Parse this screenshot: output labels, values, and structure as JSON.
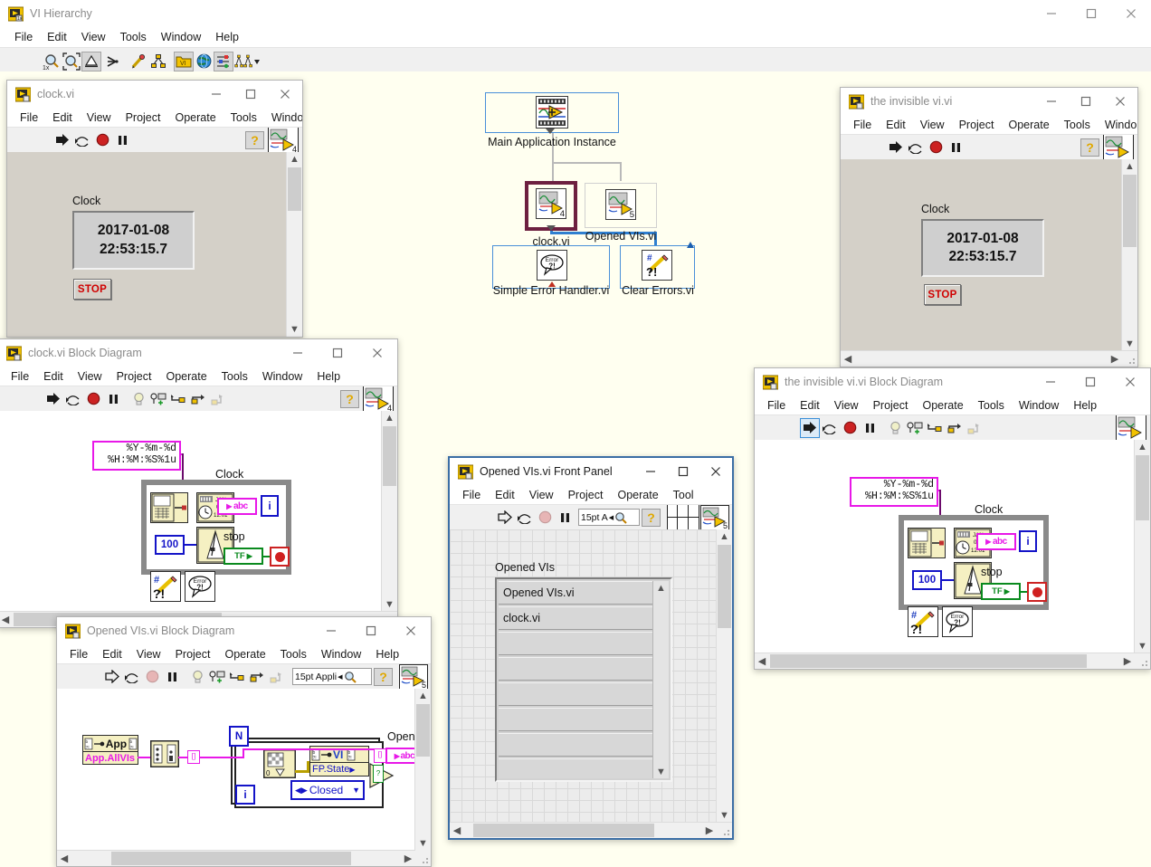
{
  "hierarchy_window": {
    "title": "VI Hierarchy",
    "icon": "labview-vi-icon",
    "menus": [
      "File",
      "Edit",
      "View",
      "Tools",
      "Window",
      "Help"
    ],
    "toolbar_icons": [
      "zoom-1x-icon",
      "zoom-fit-icon",
      "hierarchy-vertical-icon",
      "hierarchy-horizontal-icon",
      "pencil-icon",
      "tree-nodes-icon",
      "vi-folder-icon",
      "globe-icon",
      "filter-icon",
      "layout-dropdown-icon"
    ],
    "window_controls": [
      "minimize",
      "maximize",
      "close"
    ],
    "canvas_bg": "#fffff0",
    "nodes": [
      {
        "label": "Main Application Instance",
        "badge": "",
        "selected": false,
        "border": "#4a90d9"
      },
      {
        "label": "clock.vi",
        "badge": "4",
        "selected": true,
        "border": "#6d2040"
      },
      {
        "label": "Opened VIs.vi",
        "badge": "5",
        "selected": false,
        "border": "#d0d0d0"
      },
      {
        "label": "Simple Error Handler.vi",
        "badge": "",
        "selected": false,
        "border": "#4a90d9"
      },
      {
        "label": "Clear Errors.vi",
        "badge": "",
        "selected": false,
        "border": "#4a90d9"
      }
    ]
  },
  "clock_fp": {
    "title": "clock.vi",
    "menus": [
      "File",
      "Edit",
      "View",
      "Project",
      "Operate",
      "Tools",
      "Windo"
    ],
    "toolbar_icons": [
      "run-icon",
      "run-continuously-icon",
      "abort-icon",
      "pause-icon",
      "help-icon"
    ],
    "vi_badge": "4",
    "clock_label": "Clock",
    "date_value": "2017-01-08",
    "time_value": "22:53:15.7",
    "stop_label": "STOP"
  },
  "clock_bd": {
    "title": "clock.vi Block Diagram",
    "menus": [
      "File",
      "Edit",
      "View",
      "Project",
      "Operate",
      "Tools",
      "Window",
      "Help"
    ],
    "toolbar_icons": [
      "run-icon",
      "run-continuously-icon",
      "abort-icon",
      "pause-icon",
      "highlight-execution-icon",
      "retain-wire-values-icon",
      "step-into-icon",
      "step-over-icon",
      "step-out-icon",
      "help-icon"
    ],
    "vi_badge": "4",
    "format_string_line1": "%Y-%m-%d",
    "format_string_line2": "%H:%M:%S%1u",
    "clock_label": "Clock",
    "clock_terminal": "abc",
    "stop_label": "stop",
    "stop_terminal": "TF",
    "wait_constant": "100",
    "iteration_label": "i",
    "nodes": [
      "get-date-time-icon",
      "format-date-time-icon",
      "wait-ms-icon",
      "clear-errors-icon",
      "simple-error-handler-icon"
    ]
  },
  "openedvis_bd": {
    "title": "Opened VIs.vi Block Diagram",
    "menus": [
      "File",
      "Edit",
      "View",
      "Project",
      "Operate",
      "Tools",
      "Window",
      "Help"
    ],
    "toolbar_icons": [
      "run-icon",
      "run-continuously-icon",
      "abort-icon",
      "pause-icon",
      "highlight-execution-icon",
      "retain-wire-values-icon",
      "step-into-icon",
      "step-over-icon",
      "step-out-icon",
      "font-selector",
      "help-icon"
    ],
    "font_value": "15pt Appli",
    "vi_badge": "5",
    "app_node_title": "App",
    "app_property": "App.AllVIs",
    "loop_count_label": "N",
    "iteration_label": "i",
    "vi_node_title": "VI",
    "vi_property": "FP.State",
    "enum_value": "Closed",
    "compare_op": "not-equal-icon",
    "output_label": "Opened VIs",
    "output_terminal": "abc"
  },
  "openedvis_fp": {
    "title": "Opened VIs.vi Front Panel",
    "menus": [
      "File",
      "Edit",
      "View",
      "Project",
      "Operate",
      "Tool"
    ],
    "toolbar_icons": [
      "run-icon",
      "run-continuously-icon",
      "abort-icon",
      "pause-icon",
      "font-selector",
      "help-icon",
      "align-grid-icon"
    ],
    "font_value": "15pt A",
    "vi_badge": "5",
    "list_label": "Opened VIs",
    "list_items": [
      "Opened VIs.vi",
      "clock.vi",
      "",
      "",
      "",
      "",
      "",
      "",
      ""
    ]
  },
  "invisible_fp": {
    "title": "the invisible vi.vi",
    "menus": [
      "File",
      "Edit",
      "View",
      "Project",
      "Operate",
      "Tools",
      "Windo"
    ],
    "toolbar_icons": [
      "run-icon",
      "run-continuously-icon",
      "abort-icon",
      "pause-icon",
      "help-icon"
    ],
    "vi_badge": "",
    "clock_label": "Clock",
    "date_value": "2017-01-08",
    "time_value": "22:53:15.7",
    "stop_label": "STOP"
  },
  "invisible_bd": {
    "title": "the invisible vi.vi Block Diagram",
    "menus": [
      "File",
      "Edit",
      "View",
      "Project",
      "Operate",
      "Tools",
      "Window",
      "Help"
    ],
    "toolbar_icons": [
      "run-icon",
      "run-continuously-icon",
      "abort-icon",
      "pause-icon",
      "highlight-execution-icon",
      "retain-wire-values-icon",
      "step-into-icon",
      "step-over-icon",
      "step-out-icon"
    ],
    "vi_badge": "",
    "format_string_line1": "%Y-%m-%d",
    "format_string_line2": "%H:%M:%S%1u",
    "clock_label": "Clock",
    "clock_terminal": "abc",
    "stop_label": "stop",
    "stop_terminal": "TF",
    "wait_constant": "100",
    "iteration_label": "i"
  },
  "colors": {
    "canvas": "#fffff0",
    "selected_node_border": "#6d2040",
    "tree_link": "#b9b9b9",
    "blue_link": "#2f7fd0",
    "stop_red": "#d00000",
    "pink_wire": "#e818e8",
    "blue_const": "#1414c8",
    "green_bool": "#0a8a1e"
  }
}
